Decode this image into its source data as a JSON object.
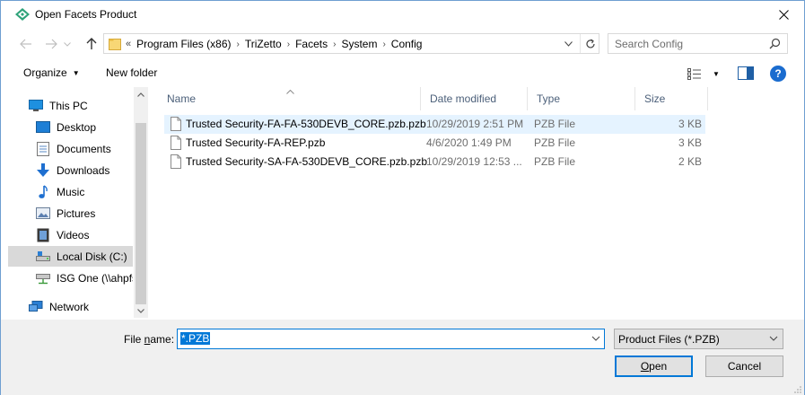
{
  "window": {
    "title": "Open Facets Product"
  },
  "nav": {
    "back_icon": "arrow-left-icon",
    "forward_icon": "arrow-right-icon",
    "up_icon": "arrow-up-icon"
  },
  "address": {
    "lead": "«",
    "crumbs": [
      "Program Files (x86)",
      "TriZetto",
      "Facets",
      "System",
      "Config"
    ]
  },
  "search": {
    "placeholder": "Search Config"
  },
  "toolbar": {
    "organize_label": "Organize",
    "new_folder_label": "New folder"
  },
  "sidebar": {
    "items": [
      {
        "label": "This PC",
        "icon": "computer-icon"
      },
      {
        "label": "Desktop",
        "icon": "desktop-icon"
      },
      {
        "label": "Documents",
        "icon": "documents-icon"
      },
      {
        "label": "Downloads",
        "icon": "downloads-icon"
      },
      {
        "label": "Music",
        "icon": "music-icon"
      },
      {
        "label": "Pictures",
        "icon": "pictures-icon"
      },
      {
        "label": "Videos",
        "icon": "videos-icon"
      },
      {
        "label": "Local Disk (C:)",
        "icon": "drive-icon"
      },
      {
        "label": "ISG One (\\\\ahpfs",
        "icon": "network-drive-icon"
      },
      {
        "label": "Network",
        "icon": "network-icon"
      }
    ]
  },
  "columns": {
    "name": "Name",
    "date": "Date modified",
    "type": "Type",
    "size": "Size"
  },
  "files": [
    {
      "name": "Trusted Security-FA-FA-530DEVB_CORE.pzb.pzb",
      "date": "10/29/2019 2:51 PM",
      "type": "PZB File",
      "size": "3 KB"
    },
    {
      "name": "Trusted Security-FA-REP.pzb",
      "date": "4/6/2020 1:49 PM",
      "type": "PZB File",
      "size": "3 KB"
    },
    {
      "name": "Trusted Security-SA-FA-530DEVB_CORE.pzb.pzb",
      "date": "10/29/2019 12:53 ...",
      "type": "PZB File",
      "size": "2 KB"
    }
  ],
  "bottom": {
    "filename_label_pre": "File ",
    "filename_label_u": "n",
    "filename_label_post": "ame:",
    "filename_value": "*.PZB",
    "filter_value": "Product Files (*.PZB)",
    "open_u": "O",
    "open_rest": "pen",
    "cancel_label": "Cancel"
  },
  "colors": {
    "accent": "#0078d7",
    "hover": "#e5f3ff",
    "selected_nav": "#d9d9d9",
    "header_text": "#4c607a"
  }
}
